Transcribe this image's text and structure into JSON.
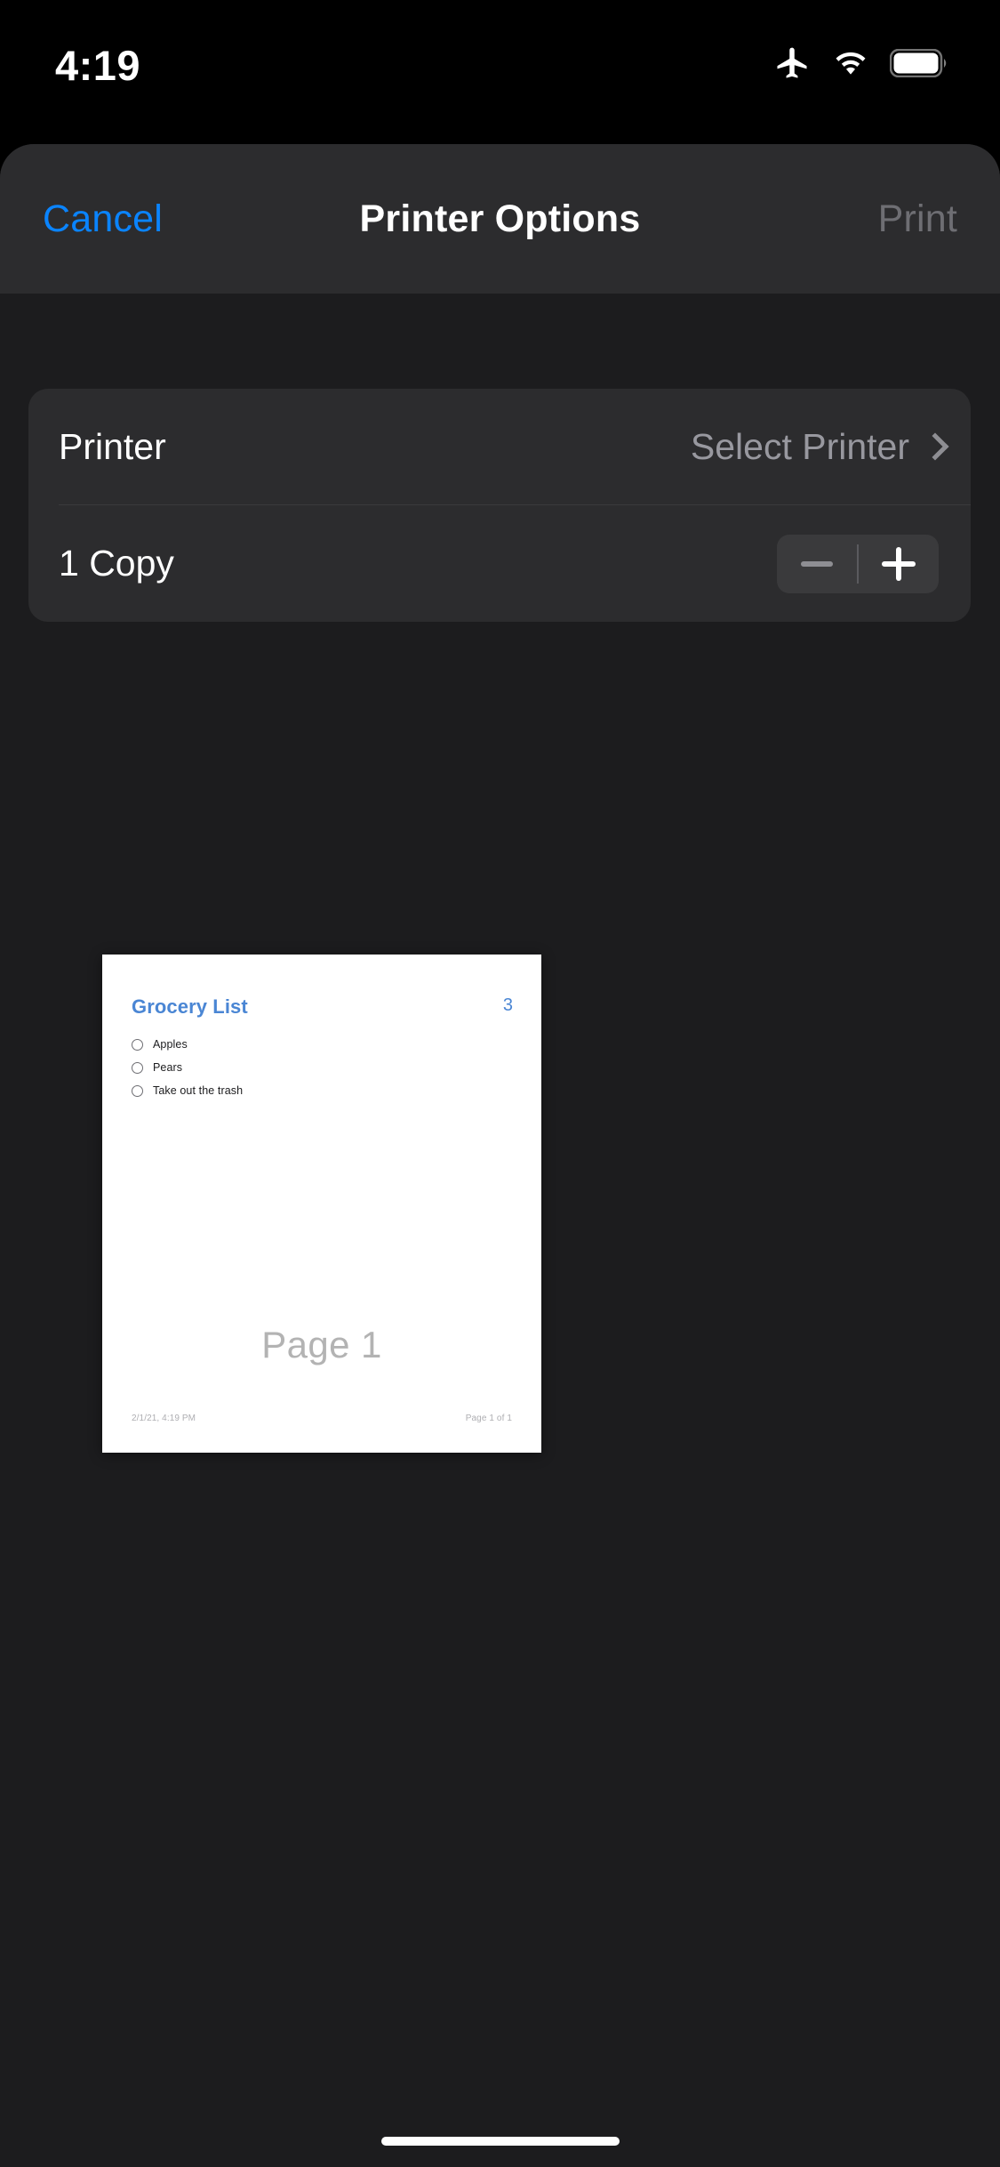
{
  "status_bar": {
    "time": "4:19",
    "icons": [
      "airplane-mode-icon",
      "wifi-icon",
      "battery-icon"
    ]
  },
  "nav_bar": {
    "cancel_label": "Cancel",
    "title": "Printer Options",
    "print_label": "Print",
    "print_enabled": false,
    "accent_color": "#0A84FF",
    "disabled_color": "#6E6E73"
  },
  "options": {
    "printer_row": {
      "label": "Printer",
      "value": "Select Printer",
      "chevron": "chevron-right-icon"
    },
    "copies_row": {
      "label": "1 Copy",
      "copies": 1,
      "decrement_icon": "minus-icon",
      "increment_icon": "plus-icon",
      "decrement_enabled": false,
      "increment_enabled": true
    }
  },
  "preview": {
    "document_title": "Grocery List",
    "item_count": "3",
    "title_color": "#4A86D4",
    "items": [
      {
        "text": "Apples",
        "checked": false
      },
      {
        "text": "Pears",
        "checked": false
      },
      {
        "text": "Take out the trash",
        "checked": false
      }
    ],
    "watermark": "Page 1",
    "footer_left": "2/1/21, 4:19 PM",
    "footer_right": "Page 1 of 1"
  },
  "home_indicator": "home-indicator"
}
